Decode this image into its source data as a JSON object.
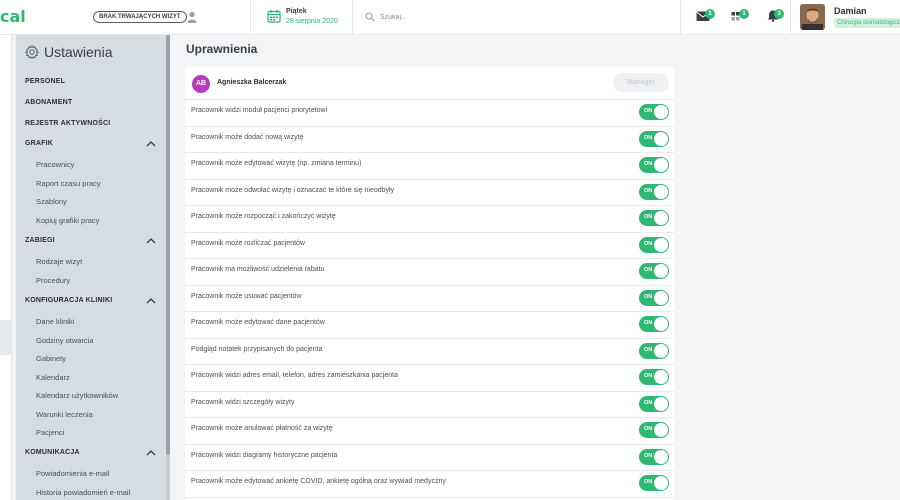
{
  "topbar": {
    "logo": "cal",
    "no_visits_label": "BRAK TRWAJĄCYCH WIZYT",
    "date_day": "Piątek",
    "date_full": "28 sierpnia 2020",
    "search_placeholder": "Szukaj...",
    "messages_badge": "1",
    "tasks_badge": "1",
    "notifications_badge": "3",
    "user_name": "Damian",
    "user_role": "Chirurgia stomatologiczna"
  },
  "sidebar": {
    "title": "Ustawienia",
    "sections": [
      {
        "label": "PERSONEL"
      },
      {
        "label": "ABONAMENT"
      },
      {
        "label": "REJESTR AKTYWNOŚCI"
      },
      {
        "label": "GRAFIK",
        "items": [
          "Pracownicy",
          "Raport czasu pracy",
          "Szablony",
          "Kopiuj grafiki pracy"
        ]
      },
      {
        "label": "ZABIEGI",
        "items": [
          "Rodzaje wizyt",
          "Procedury"
        ]
      },
      {
        "label": "KONFIGURACJA KLINIKI",
        "items": [
          "Dane kliniki",
          "Godziny otwarcia",
          "Gabinety",
          "Kalendarz",
          "Kalendarz użytkowników",
          "Warunki leczenia",
          "Pacjenci"
        ]
      },
      {
        "label": "KOMUNIKACJA",
        "items": [
          "Powiadomienia e-mail",
          "Historia powiadomień e-mail"
        ]
      }
    ]
  },
  "main": {
    "title": "Uprawnienia",
    "employee_initials": "AB",
    "employee_name": "Agnieszka Balcerzak",
    "role_button": "Manager",
    "toggle_on_label": "ON",
    "permissions": [
      {
        "label": "Pracownik widzi moduł pacjenci priorytetowi",
        "on": true
      },
      {
        "label": "Pracownik może dodać nową wizytę",
        "on": true
      },
      {
        "label": "Pracownik może edytować wizytę (np. zmiana terminu)",
        "on": true
      },
      {
        "label": "Pracownik może odwołać wizytę i oznaczać te które się nieodbyły",
        "on": true
      },
      {
        "label": "Pracownik może rozpocząć i zakończyć wizytę",
        "on": true
      },
      {
        "label": "Pracownik może rozliczać pacjentów",
        "on": true
      },
      {
        "label": "Pracownik ma możliwość udzielenia rabatu",
        "on": true
      },
      {
        "label": "Pracownik może usuwać pacjentów",
        "on": true
      },
      {
        "label": "Pracownik może edytować dane pacjentów",
        "on": true
      },
      {
        "label": "Podgląd notatek przypisanych do pacjenta",
        "on": true
      },
      {
        "label": "Pracownik widzi adres email, telefon, adres zamieszkania pacjenta",
        "on": true
      },
      {
        "label": "Pracownik widzi szczegóły wizyty",
        "on": true
      },
      {
        "label": "Pracownik może anulować płatność za wizytę",
        "on": true
      },
      {
        "label": "Pracownik widzi diagramy historyczne pacjenta",
        "on": true
      },
      {
        "label": "Pracownik może edytować ankietę COVID, ankietę ogólną oraz wywiad medyczny",
        "on": true
      }
    ]
  },
  "colors": {
    "accent": "#2eb872",
    "sidebar_bg": "#d5dde2",
    "avatar_bg": "#b83bbf"
  },
  "icons": {
    "sidebar": "gear-icon",
    "date": "calendar-icon",
    "search": "search-icon",
    "messages": "envelope-icon",
    "tasks": "tasks-icon",
    "notifications": "bell-icon",
    "section_toggle": "chevron-up-icon"
  }
}
